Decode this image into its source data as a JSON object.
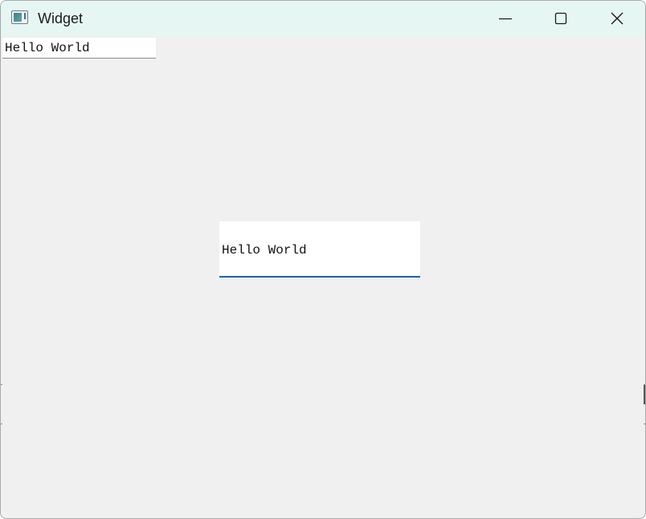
{
  "window": {
    "title": "Widget",
    "icon": "app-window-icon",
    "controls": {
      "minimize_icon": "minimize-icon",
      "maximize_icon": "maximize-icon",
      "close_icon": "close-icon"
    }
  },
  "content": {
    "top_line_edit": {
      "value": "Hello World"
    },
    "center_line_edit": {
      "value": "Hello World"
    }
  },
  "colors": {
    "titlebar": "#e6f6f3",
    "client_background": "#f0f0f0",
    "focus_underline": "#1a63b5"
  }
}
